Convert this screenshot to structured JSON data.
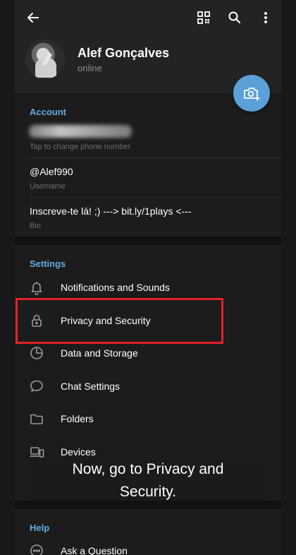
{
  "profile": {
    "name": "Alef Gonçalves",
    "status": "online"
  },
  "account": {
    "title": "Account",
    "phone_hint": "Tap to change phone number",
    "username": "@Alef990",
    "username_label": "Username",
    "bio": "Inscreve-te lá! ;) ---> bit.ly/1plays <---",
    "bio_label": "Bio"
  },
  "settings": {
    "title": "Settings",
    "items": [
      {
        "label": "Notifications and Sounds",
        "icon": "bell-icon"
      },
      {
        "label": "Privacy and Security",
        "icon": "lock-icon"
      },
      {
        "label": "Data and Storage",
        "icon": "pie-chart-icon"
      },
      {
        "label": "Chat Settings",
        "icon": "chat-bubble-icon"
      },
      {
        "label": "Folders",
        "icon": "folder-icon"
      },
      {
        "label": "Devices",
        "icon": "devices-icon"
      }
    ]
  },
  "help": {
    "title": "Help",
    "items": [
      {
        "label": "Ask a Question",
        "icon": "question-bubble-icon"
      }
    ]
  },
  "caption": {
    "line1": "Now, go to Privacy and",
    "line2": "Security."
  },
  "colors": {
    "accent": "#64a9e0",
    "fab": "#5ba0d8",
    "highlight": "#e3222a",
    "background": "#1c1c1c"
  }
}
